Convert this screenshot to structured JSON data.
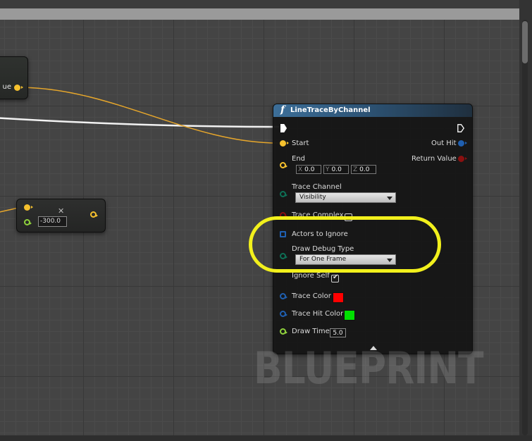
{
  "editor": {
    "watermark": "BLUEPRINT"
  },
  "nodes": {
    "left_partial": {
      "pin_label": "ue"
    },
    "small": {
      "value": "-300.0"
    },
    "line_trace": {
      "title": "LineTraceByChannel",
      "pins": {
        "start": "Start",
        "end": "End",
        "out_hit": "Out Hit",
        "return_value": "Return Value",
        "trace_channel": "Trace Channel",
        "trace_complex": "Trace Complex",
        "actors_to_ignore": "Actors to Ignore",
        "draw_debug_type": "Draw Debug Type",
        "ignore_self": "Ignore Self",
        "trace_color": "Trace Color",
        "trace_hit_color": "Trace Hit Color",
        "draw_time": "Draw Time"
      },
      "end_vector": {
        "x_label": "X",
        "x": "0.0",
        "y_label": "Y",
        "y": "0.0",
        "z_label": "Z",
        "z": "0.0"
      },
      "trace_channel_value": "Visibility",
      "draw_debug_value": "For One Frame",
      "draw_time_value": "5.0",
      "trace_color_hex": "#ff0000",
      "trace_hit_color_hex": "#00e000"
    }
  },
  "colors": {
    "highlight": "#f2f01c",
    "vector_pin": "#f6c12e",
    "struct_pin": "#1f5fb0",
    "bool_pin": "#8a1010",
    "byte_pin": "#0e6f55",
    "float_pin": "#8fd13c",
    "exec_pin": "#ffffff"
  }
}
